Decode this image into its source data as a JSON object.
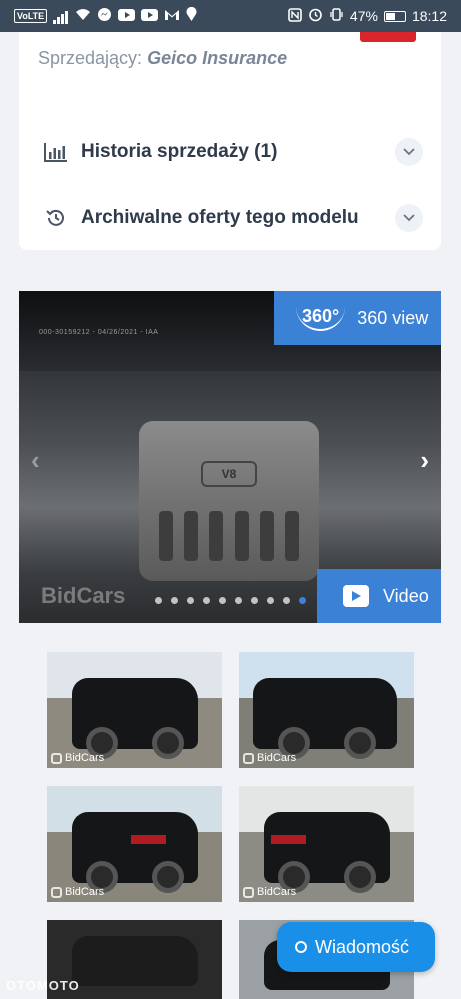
{
  "status_bar": {
    "volte": "VoLTE",
    "battery": "47%",
    "time": "18:12"
  },
  "details": {
    "seller_label": "Sprzedający:",
    "seller_name": "Geico Insurance",
    "accordion": [
      {
        "label": "Historia sprzedaży (1)",
        "icon": "bar-chart-icon"
      },
      {
        "label": "Archiwalne oferty tego modelu",
        "icon": "history-icon"
      }
    ]
  },
  "gallery": {
    "view360_badge": "360°",
    "view360_label": "360 view",
    "video_label": "Video",
    "watermark": "BidCars",
    "image_stamp": "000-30159212 - 04/26/2021 - IAA",
    "slide_count": 10,
    "active_slide": 10,
    "engine_badge": "V8"
  },
  "thumbnails": [
    {
      "watermark": "BidCars"
    },
    {
      "watermark": "BidCars"
    },
    {
      "watermark": "BidCars"
    },
    {
      "watermark": "BidCars"
    }
  ],
  "message_button": {
    "label": "Wiadomość"
  },
  "brand_watermark": "OTOMOTO",
  "colors": {
    "accent": "#3b82d6",
    "message_button": "#1a8fe8",
    "status_bar": "#3b4a5a"
  }
}
